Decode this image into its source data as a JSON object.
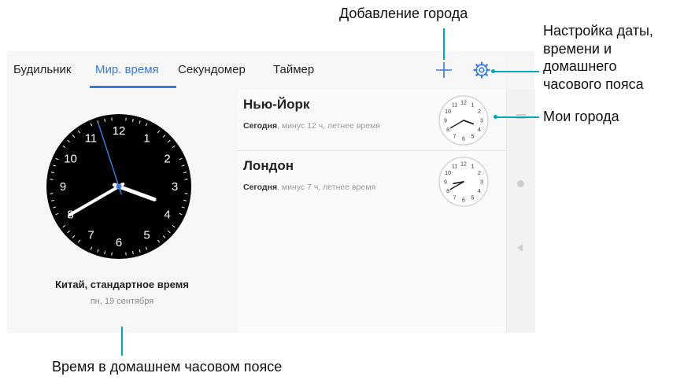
{
  "tabs": [
    {
      "label": "Будильник",
      "active": false
    },
    {
      "label": "Мир. время",
      "active": true
    },
    {
      "label": "Секундомер",
      "active": false
    },
    {
      "label": "Таймер",
      "active": false
    }
  ],
  "home": {
    "city": "Китай, стандартное время",
    "date": "пн, 19 сентября",
    "clock_numbers": [
      "12",
      "1",
      "2",
      "3",
      "4",
      "5",
      "6",
      "7",
      "8",
      "9",
      "10",
      "11"
    ],
    "time": {
      "hour": 3,
      "minute": 40,
      "second": 57
    }
  },
  "cities": [
    {
      "name": "Нью-Йорк",
      "day": "Сегодня",
      "offset": ", минус 12 ч, летнее время",
      "time": {
        "hour": 3,
        "minute": 40
      }
    },
    {
      "name": "Лондон",
      "day": "Сегодня",
      "offset": ", минус 7 ч, летнее время",
      "time": {
        "hour": 8,
        "minute": 40
      }
    }
  ],
  "mini_clock_numbers": [
    "12",
    "1",
    "2",
    "3",
    "4",
    "5",
    "6",
    "7",
    "8",
    "9",
    "10",
    "11"
  ],
  "callouts": {
    "add_city": "Добавление города",
    "settings": [
      "Настройка даты,",
      "времени и",
      "домашнего",
      "часового пояса"
    ],
    "my_cities": "Мои города",
    "home_time": "Время в домашнем часовом поясе"
  },
  "icons": {
    "add": "plus-icon",
    "settings": "gear-icon"
  },
  "colors": {
    "accent": "#3a7bd5",
    "callout": "#00a9b5",
    "home_clock_face": "#000000",
    "second_hand": "#3a7bd5"
  }
}
